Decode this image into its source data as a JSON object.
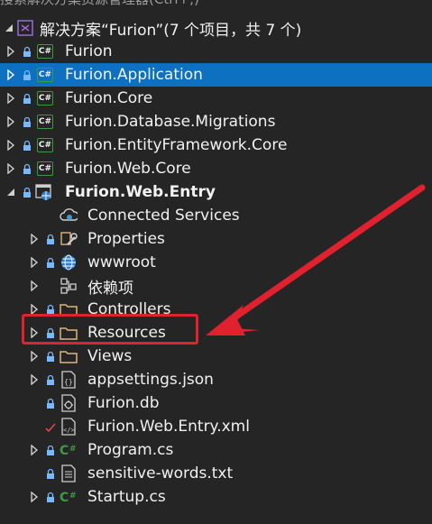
{
  "solution": {
    "clipped_top_text": "搜索解决方案资源管理器(Ctrl+;)",
    "title": "解决方案“Furion”(7 个项目，共 7 个)"
  },
  "projects": [
    {
      "label": "Furion",
      "selected": false
    },
    {
      "label": "Furion.Application",
      "selected": true
    },
    {
      "label": "Furion.Core",
      "selected": false
    },
    {
      "label": "Furion.Database.Migrations",
      "selected": false
    },
    {
      "label": "Furion.EntityFramework.Core",
      "selected": false
    },
    {
      "label": "Furion.Web.Core",
      "selected": false
    }
  ],
  "entry_project": {
    "label": "Furion.Web.Entry"
  },
  "children": [
    {
      "label": "Connected Services",
      "icon": "connected-services-icon",
      "expandable": false,
      "lock": false
    },
    {
      "label": "Properties",
      "icon": "wrench-icon",
      "expandable": true,
      "lock": true
    },
    {
      "label": "wwwroot",
      "icon": "globe-icon",
      "expandable": true,
      "lock": true
    },
    {
      "label": "依赖项",
      "icon": "dependencies-icon",
      "expandable": true,
      "lock": false
    },
    {
      "label": "Controllers",
      "icon": "folder-icon",
      "expandable": true,
      "lock": true
    },
    {
      "label": "Resources",
      "icon": "folder-icon",
      "expandable": true,
      "lock": true
    },
    {
      "label": "Views",
      "icon": "folder-icon",
      "expandable": true,
      "lock": true
    },
    {
      "label": "appsettings.json",
      "icon": "json-file-icon",
      "expandable": true,
      "lock": true
    },
    {
      "label": "Furion.db",
      "icon": "db-file-icon",
      "expandable": false,
      "lock": true
    },
    {
      "label": "Furion.Web.Entry.xml",
      "icon": "xml-file-icon",
      "expandable": false,
      "lock": false,
      "check": true
    },
    {
      "label": "Program.cs",
      "icon": "csharp-file-icon",
      "expandable": true,
      "lock": true
    },
    {
      "label": "sensitive-words.txt",
      "icon": "text-file-icon",
      "expandable": false,
      "lock": true
    },
    {
      "label": "Startup.cs",
      "icon": "csharp-file-icon",
      "expandable": true,
      "lock": true
    }
  ],
  "colors": {
    "background": "#252526",
    "selection": "#0e70c0",
    "annotation": "#e0212e",
    "csproj_green": "#3c9a42",
    "folder": "#dcb67a"
  }
}
